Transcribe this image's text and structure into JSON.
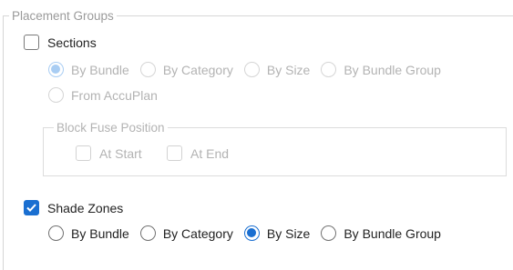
{
  "placement_groups": {
    "title": "Placement Groups",
    "sections": {
      "label": "Sections",
      "checked": false,
      "radio_options": [
        "By Bundle",
        "By Category",
        "By Size",
        "By Bundle Group",
        "From AccuPlan"
      ],
      "selected": "By Bundle",
      "enabled": false,
      "block_fuse_position": {
        "title": "Block Fuse Position",
        "options": [
          {
            "label": "At Start",
            "checked": false
          },
          {
            "label": "At End",
            "checked": false
          }
        ]
      }
    },
    "shade_zones": {
      "label": "Shade Zones",
      "checked": true,
      "radio_options": [
        "By Bundle",
        "By Category",
        "By Size",
        "By Bundle Group"
      ],
      "selected": "By Size",
      "enabled": true
    }
  },
  "colors": {
    "accent": "#1a6fd1",
    "disabled_text": "#b3b3b3",
    "frame_border": "#d6d6d6"
  }
}
